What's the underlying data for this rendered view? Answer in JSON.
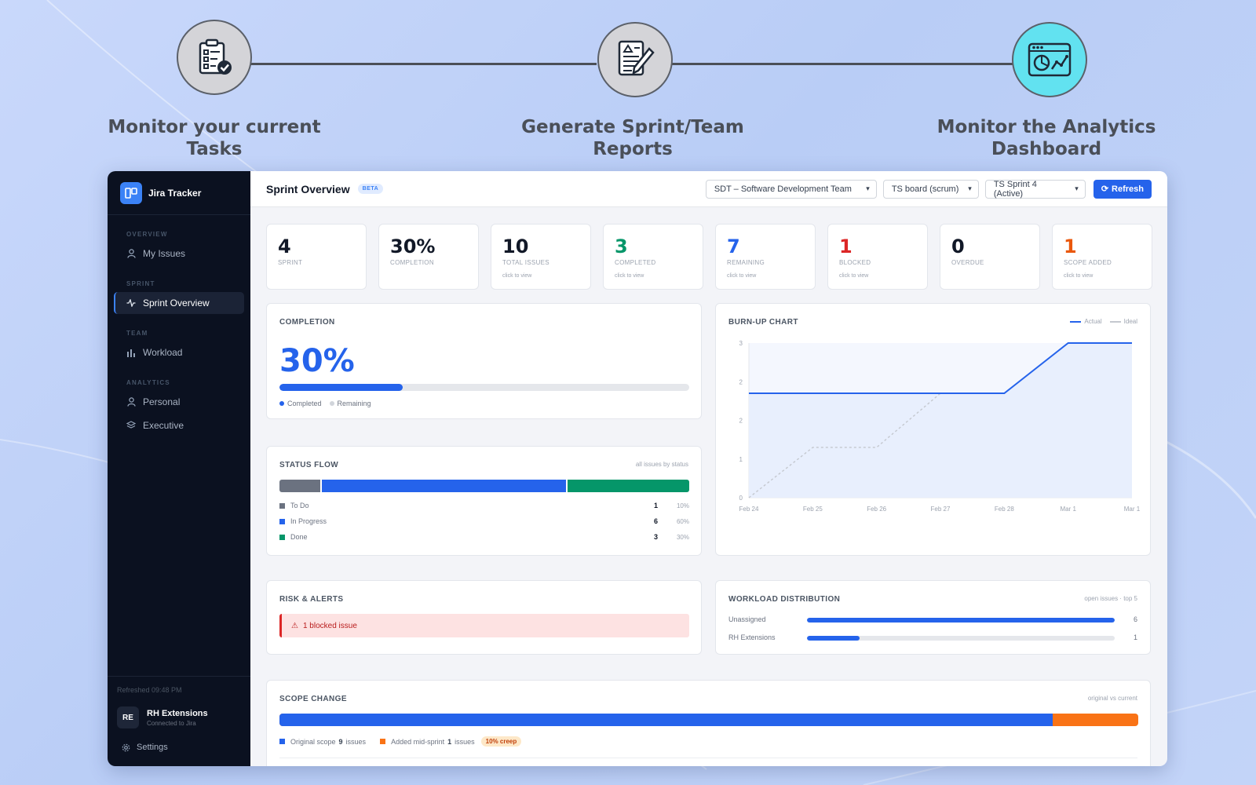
{
  "flow": {
    "steps": [
      {
        "title": "Monitor your current Tasks",
        "icon": "clipboard-check-icon"
      },
      {
        "title": "Generate Sprint/Team Reports",
        "icon": "report-edit-icon"
      },
      {
        "title": "Monitor the Analytics Dashboard",
        "icon": "analytics-dashboard-icon"
      }
    ]
  },
  "sidebar": {
    "brand": "Jira Tracker",
    "sections": {
      "overview": "OVERVIEW",
      "sprint": "SPRINT",
      "team": "TEAM",
      "analytics": "ANALYTICS"
    },
    "items": {
      "my_issues": "My Issues",
      "sprint_overview": "Sprint Overview",
      "workload": "Workload",
      "personal": "Personal",
      "executive": "Executive"
    },
    "refreshed": "Refreshed 09:48 PM",
    "user": {
      "initials": "RE",
      "name": "RH Extensions",
      "status": "Connected to Jira"
    },
    "settings": "Settings"
  },
  "header": {
    "title": "Sprint Overview",
    "badge": "BETA",
    "project_select": "SDT – Software Development Team",
    "board_select": "TS board (scrum)",
    "sprint_select": "TS Sprint 4 (Active)",
    "refresh": "Refresh"
  },
  "stats": [
    {
      "value": "4",
      "label": "SPRINT",
      "sub": "",
      "color": "#111827"
    },
    {
      "value": "30%",
      "label": "COMPLETION",
      "sub": "",
      "color": "#111827"
    },
    {
      "value": "10",
      "label": "TOTAL ISSUES",
      "sub": "click to view",
      "color": "#111827"
    },
    {
      "value": "3",
      "label": "COMPLETED",
      "sub": "click to view",
      "color": "#059669"
    },
    {
      "value": "7",
      "label": "REMAINING",
      "sub": "click to view",
      "color": "#2563eb"
    },
    {
      "value": "1",
      "label": "BLOCKED",
      "sub": "click to view",
      "color": "#dc2626"
    },
    {
      "value": "0",
      "label": "OVERDUE",
      "sub": "",
      "color": "#111827"
    },
    {
      "value": "1",
      "label": "SCOPE ADDED",
      "sub": "click to view",
      "color": "#ea580c"
    }
  ],
  "completion": {
    "title": "COMPLETION",
    "value": "30%",
    "fraction": 0.3,
    "legend_completed": "Completed",
    "legend_remaining": "Remaining"
  },
  "status_flow": {
    "title": "STATUS FLOW",
    "note": "all issues by status",
    "rows": [
      {
        "label": "To Do",
        "count": "1",
        "pct": "10%",
        "fraction": 0.1,
        "color": "#6b7280"
      },
      {
        "label": "In Progress",
        "count": "6",
        "pct": "60%",
        "fraction": 0.6,
        "color": "#2563eb"
      },
      {
        "label": "Done",
        "count": "3",
        "pct": "30%",
        "fraction": 0.3,
        "color": "#059669"
      }
    ]
  },
  "risk": {
    "title": "RISK & ALERTS",
    "alert": "1 blocked issue"
  },
  "workload": {
    "title": "WORKLOAD DISTRIBUTION",
    "note": "open issues · top 5",
    "rows": [
      {
        "name": "Unassigned",
        "value": "6",
        "fraction": 1.0
      },
      {
        "name": "RH Extensions",
        "value": "1",
        "fraction": 0.17
      }
    ]
  },
  "scope": {
    "title": "SCOPE CHANGE",
    "note": "original vs current",
    "original_label": "Original scope",
    "original_value": "9",
    "added_label": "Added mid-sprint",
    "added_value": "1",
    "unit": "issues",
    "creep": "10% creep",
    "original_fraction": 0.9
  },
  "chart_data": {
    "type": "line",
    "title": "BURN-UP CHART",
    "x": [
      "Feb 24",
      "Feb 25",
      "Feb 26",
      "Feb 27",
      "Feb 28",
      "Mar 1",
      "Mar 1"
    ],
    "ytick_labels": [
      "0",
      "1",
      "2",
      "2",
      "3"
    ],
    "ylim": [
      0,
      4
    ],
    "grid": false,
    "legend": "top-right",
    "series": [
      {
        "name": "Actual",
        "values": [
          2.7,
          2.7,
          2.7,
          2.7,
          2.7,
          4,
          4
        ],
        "color": "#2563eb",
        "style": "solid"
      },
      {
        "name": "Ideal",
        "values": [
          0,
          1.3,
          1.3,
          2.7,
          2.7,
          4,
          4
        ],
        "color": "#c4c8cf",
        "style": "dashed"
      }
    ]
  },
  "colors": {
    "accent": "#2563eb",
    "sidebar_bg": "#0b1120",
    "orange": "#f97316"
  }
}
